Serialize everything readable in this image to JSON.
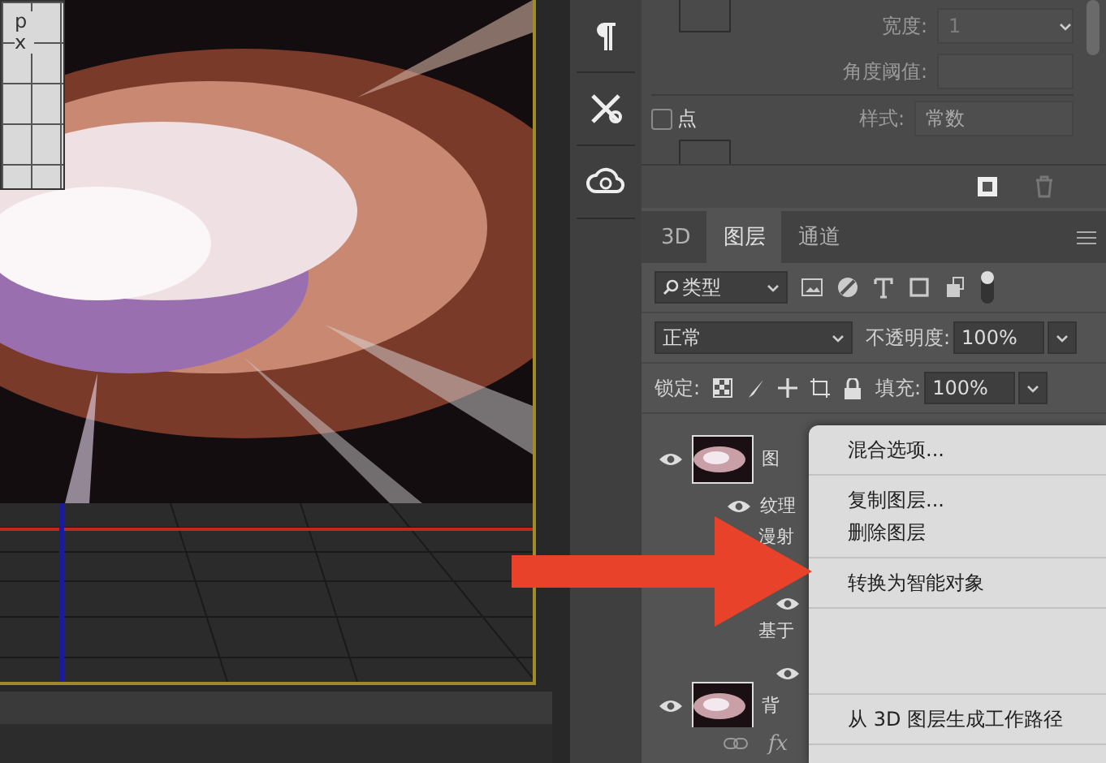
{
  "canvas": {
    "ruler_label": "px"
  },
  "properties": {
    "width_label": "宽度:",
    "width_value": "1",
    "angle_label": "角度阈值:",
    "point": {
      "label": "点",
      "checked": false
    },
    "style_label": "样式:",
    "style_value": "常数"
  },
  "layers_panel": {
    "tabs": [
      {
        "label": "3D",
        "selected": false
      },
      {
        "label": "图层",
        "selected": true
      },
      {
        "label": "通道",
        "selected": false
      }
    ],
    "filter": "类型",
    "blend_mode": "正常",
    "opacity_label": "不透明度:",
    "opacity": "100%",
    "lock_label": "锁定:",
    "fill_label": "填充:",
    "fill": "100%",
    "layers": [
      {
        "name": "图",
        "visible": true,
        "children": [
          {
            "name": "纹理",
            "visible": true
          },
          {
            "name": "漫射",
            "children": [
              {
                "visible": true
              }
            ]
          },
          {
            "name": "基于",
            "children": [
              {
                "visible": true
              }
            ]
          }
        ]
      },
      {
        "name": "背",
        "visible": true
      }
    ],
    "footer_fx": "fx"
  },
  "context_menu": {
    "groups": [
      [
        "混合选项..."
      ],
      [
        "复制图层...",
        "删除图层"
      ],
      [
        "转换为智能对象"
      ],
      [
        "从 3D 图层生成工作路径"
      ]
    ]
  }
}
